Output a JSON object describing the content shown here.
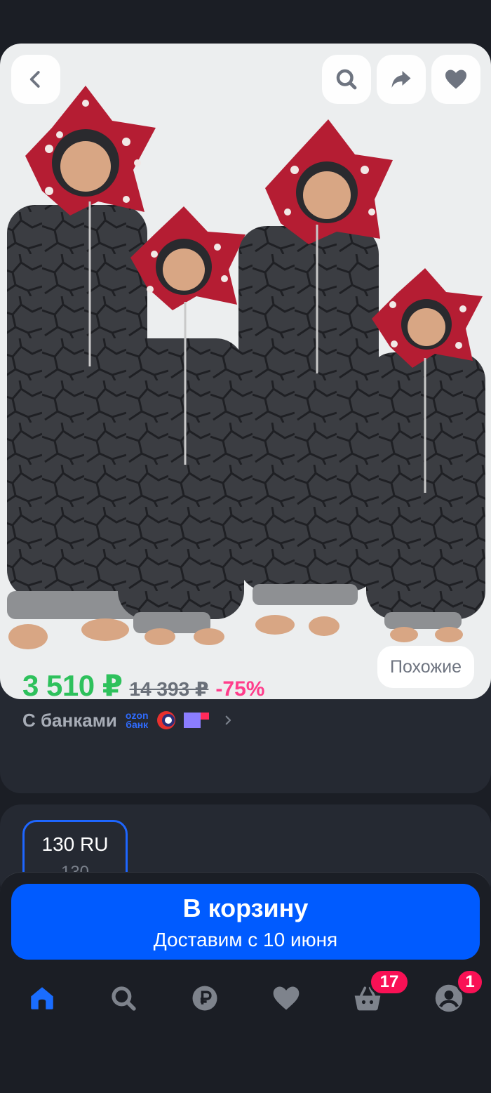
{
  "product": {
    "similar_label": "Похожие",
    "price": "3 510 ₽",
    "old_price": "14 393 ₽",
    "discount": "-75%",
    "banks_label": "С банками",
    "ozon_bank_logo": [
      "ozon",
      "банк"
    ]
  },
  "size": {
    "selected": "130 RU",
    "selected_sub": "130"
  },
  "cart": {
    "title": "В корзину",
    "delivery": "Доставим с 10 июня"
  },
  "nav": {
    "items": [
      "home-icon",
      "search-icon",
      "ruble-icon",
      "heart-icon",
      "basket-icon",
      "profile-icon"
    ],
    "basket_badge": "17",
    "profile_badge": "1"
  },
  "colors": {
    "accent": "#005bff",
    "price": "#2ec15c",
    "discount": "#ff3d8b",
    "badge": "#f91155",
    "background": "#1b1e25"
  }
}
